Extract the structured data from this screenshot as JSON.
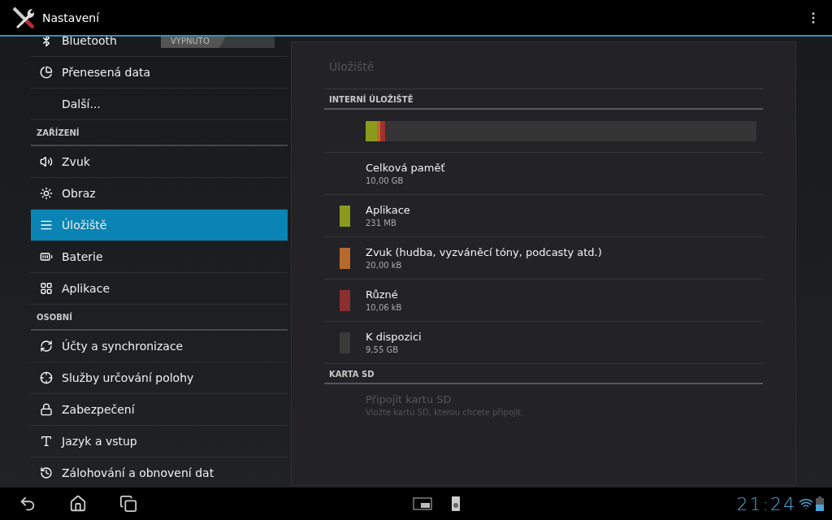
{
  "action_bar": {
    "title": "Nastavení"
  },
  "sidebar": {
    "items": [
      {
        "kind": "item",
        "label": "Bluetooth",
        "selected": false,
        "toggle": {
          "label": "VYPNUTO",
          "on": false
        }
      },
      {
        "kind": "item",
        "label": "Přenesená data",
        "selected": false
      },
      {
        "kind": "item",
        "label": "Další...",
        "selected": false
      },
      {
        "kind": "header",
        "label": "ZAŘÍZENÍ"
      },
      {
        "kind": "item",
        "label": "Zvuk",
        "selected": false
      },
      {
        "kind": "item",
        "label": "Obraz",
        "selected": false
      },
      {
        "kind": "item",
        "label": "Úložiště",
        "selected": true
      },
      {
        "kind": "item",
        "label": "Baterie",
        "selected": false
      },
      {
        "kind": "item",
        "label": "Aplikace",
        "selected": false
      },
      {
        "kind": "header",
        "label": "OSOBNÍ"
      },
      {
        "kind": "item",
        "label": "Účty a synchronizace",
        "selected": false
      },
      {
        "kind": "item",
        "label": "Služby určování polohy",
        "selected": false
      },
      {
        "kind": "item",
        "label": "Zabezpečení",
        "selected": false
      },
      {
        "kind": "item",
        "label": "Jazyk a vstup",
        "selected": false
      },
      {
        "kind": "item",
        "label": "Zálohování a obnovení dat",
        "selected": false
      }
    ]
  },
  "detail": {
    "title": "Úložiště",
    "sections": [
      {
        "header": "INTERNÍ ÚLOŽIŠTĚ",
        "usage_bar": [
          {
            "level": 0.03,
            "color": "#8a9a1c"
          },
          {
            "level": 0.008,
            "color": "#c06a2a"
          },
          {
            "level": 0.012,
            "color": "#a03030"
          }
        ],
        "entries": [
          {
            "title": "Celková paměť",
            "value": "10,00 GB",
            "disabled": false
          },
          {
            "title": "Aplikace",
            "value": "231 MB",
            "color": "#8a9a1c",
            "disabled": false
          },
          {
            "title": "Zvuk (hudba, vyzváněcí tóny, podcasty atd.)",
            "value": "20,00 kB",
            "color": "#b8692e",
            "disabled": false
          },
          {
            "title": "Různé",
            "value": "10,06 kB",
            "color": "#8c2f2f",
            "disabled": false
          },
          {
            "title": "K dispozici",
            "value": "9,55 GB",
            "color": "#3a3a3a",
            "disabled": false
          }
        ]
      },
      {
        "header": "KARTA SD",
        "entries": [
          {
            "title": "Připojit kartu SD",
            "value": "Vložte kartu SD, kterou chcete připojit.",
            "disabled": true
          }
        ]
      }
    ]
  },
  "system_bar": {
    "clock": "21:24"
  }
}
